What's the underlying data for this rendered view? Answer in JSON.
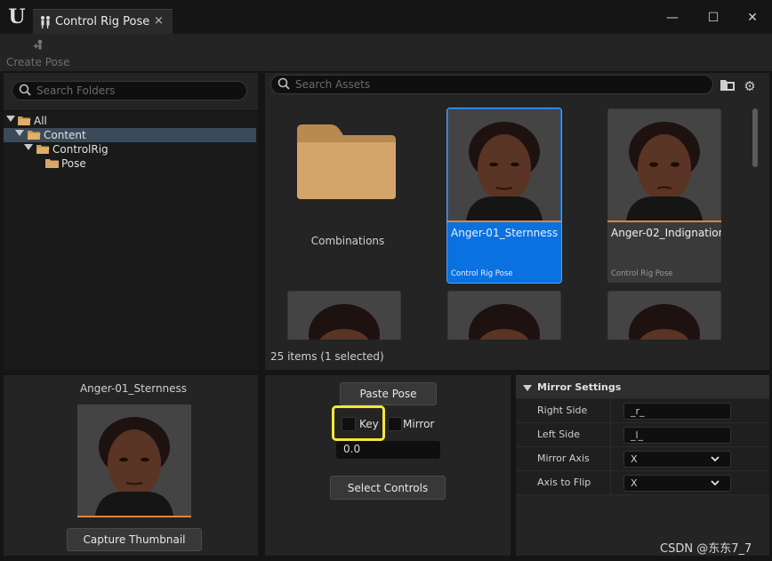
{
  "window": {
    "tab_title": "Control Rig Pose",
    "tab_close": "×",
    "minimize": "—",
    "maximize": "☐",
    "close": "✕"
  },
  "toolbar": {
    "create_pose_label": "Create Pose"
  },
  "folders": {
    "search_placeholder": "Search Folders",
    "tree": [
      {
        "label": "All",
        "depth": 0,
        "expanded": true,
        "selected": false
      },
      {
        "label": "Content",
        "depth": 1,
        "expanded": true,
        "selected": true
      },
      {
        "label": "ControlRig",
        "depth": 2,
        "expanded": true,
        "selected": false
      },
      {
        "label": "Pose",
        "depth": 3,
        "expanded": false,
        "selected": false
      }
    ]
  },
  "assets": {
    "search_placeholder": "Search Assets",
    "folder_tile": {
      "name": "Combinations"
    },
    "cards": [
      {
        "name": "Anger-01_Sternness",
        "type": "Control Rig Pose",
        "selected": true
      },
      {
        "name": "Anger-02_Indignation",
        "type": "Control Rig Pose",
        "selected": false
      }
    ],
    "count_label": "25 items (1 selected)"
  },
  "thumbnail_panel": {
    "title": "Anger-01_Sternness",
    "capture_button": "Capture Thumbnail"
  },
  "paste_panel": {
    "paste_button": "Paste Pose",
    "key_label": "Key",
    "mirror_label": "Mirror",
    "blend_value": "0.0",
    "select_button": "Select Controls"
  },
  "mirror_settings": {
    "header": "Mirror Settings",
    "rows": [
      {
        "label": "Right Side",
        "value": "_r_"
      },
      {
        "label": "Left Side",
        "value": "_l_"
      },
      {
        "label": "Mirror Axis",
        "value": "X"
      },
      {
        "label": "Axis to Flip",
        "value": "X"
      }
    ]
  },
  "watermark": "CSDN @东东7_7",
  "colors": {
    "accent_blue": "#0a72e0",
    "orange_bar": "#e0843a",
    "highlight_yellow": "#f5e63a"
  }
}
